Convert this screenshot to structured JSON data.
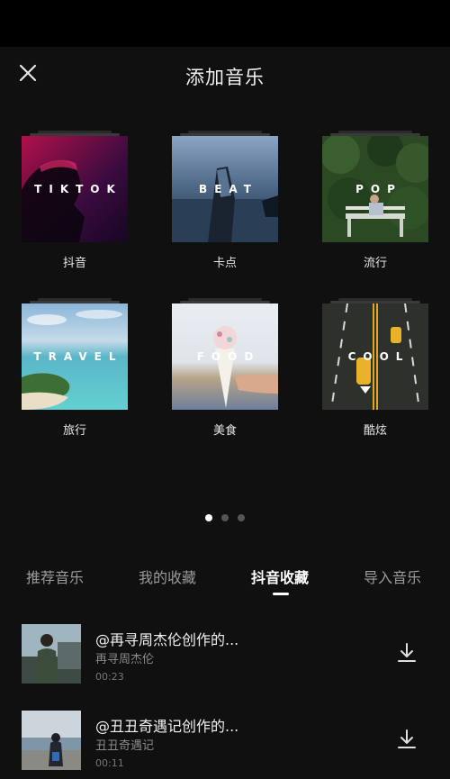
{
  "header": {
    "title": "添加音乐"
  },
  "categories": [
    {
      "word": "TIKTOK",
      "label": "抖音"
    },
    {
      "word": "BEAT",
      "label": "卡点"
    },
    {
      "word": "POP",
      "label": "流行"
    },
    {
      "word": "TRAVEL",
      "label": "旅行"
    },
    {
      "word": "FOOD",
      "label": "美食"
    },
    {
      "word": "COOL",
      "label": "酷炫"
    }
  ],
  "pagination": {
    "pages": 3,
    "active": 1
  },
  "tabs": [
    {
      "label": "推荐音乐"
    },
    {
      "label": "我的收藏"
    },
    {
      "label": "抖音收藏",
      "active": true
    },
    {
      "label": "导入音乐"
    }
  ],
  "songs": [
    {
      "title": "@再寻周杰伦创作的...",
      "artist": "再寻周杰伦",
      "duration": "00:23"
    },
    {
      "title": "@丑丑奇遇记创作的...",
      "artist": "丑丑奇遇记",
      "duration": "00:11"
    }
  ],
  "icons": {
    "close": "close-icon",
    "download": "download-icon"
  }
}
